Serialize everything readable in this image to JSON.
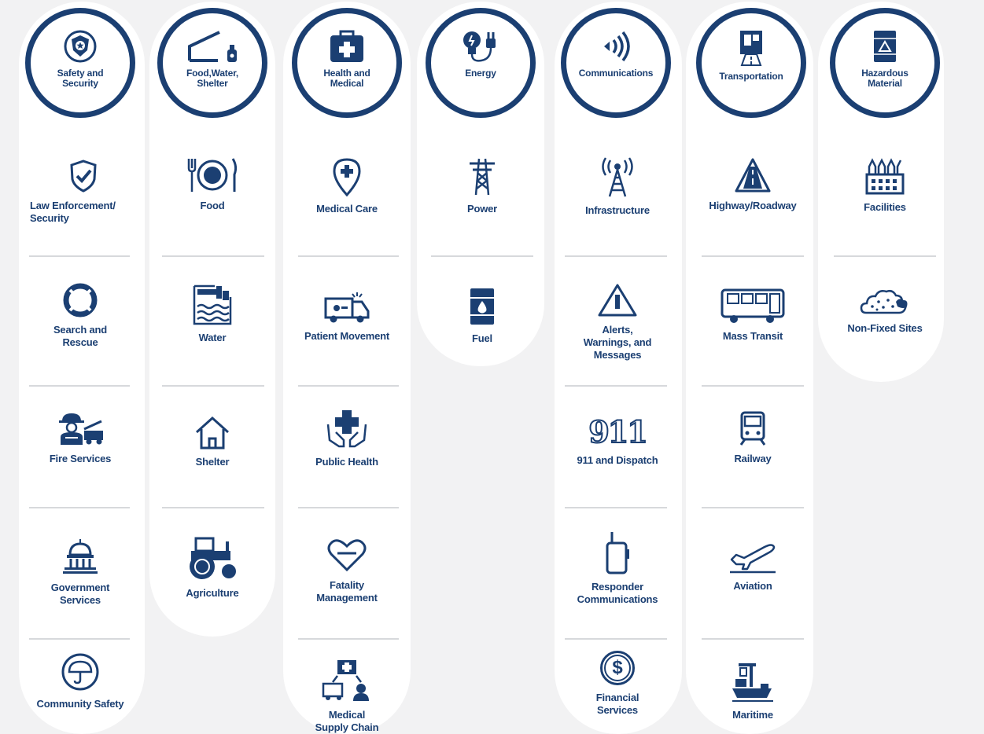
{
  "accent_color": "#1b3f72",
  "lifelines": [
    {
      "name": "Safety and\nSecurity",
      "icon": "police-badge-icon",
      "components": [
        {
          "label": "Law Enforcement/\nSecurity",
          "icon": "shield-check-icon"
        },
        {
          "label": "Search and\nRescue",
          "icon": "lifebuoy-icon"
        },
        {
          "label": "Fire Services",
          "icon": "firefighter-icon"
        },
        {
          "label": "Government\nServices",
          "icon": "capitol-icon"
        },
        {
          "label": "Community Safety",
          "icon": "umbrella-icon"
        }
      ]
    },
    {
      "name": "Food,Water,\nShelter",
      "icon": "shelter-bottle-icon",
      "components": [
        {
          "label": "Food",
          "icon": "plate-cutlery-icon"
        },
        {
          "label": "Water",
          "icon": "water-pipe-icon"
        },
        {
          "label": "Shelter",
          "icon": "house-icon"
        },
        {
          "label": "Agriculture",
          "icon": "tractor-icon"
        }
      ]
    },
    {
      "name": "Health and\nMedical",
      "icon": "medical-kit-icon",
      "components": [
        {
          "label": "Medical Care",
          "icon": "map-pin-cross-icon"
        },
        {
          "label": "Patient Movement",
          "icon": "ambulance-icon"
        },
        {
          "label": "Public Health",
          "icon": "hands-cross-icon"
        },
        {
          "label": "Fatality\nManagement",
          "icon": "heart-icon"
        },
        {
          "label": "Medical\nSupply Chain",
          "icon": "supply-chain-icon"
        }
      ]
    },
    {
      "name": "Energy",
      "icon": "bulb-plug-icon",
      "components": [
        {
          "label": "Power",
          "icon": "power-tower-icon"
        },
        {
          "label": "Fuel",
          "icon": "fuel-barrel-icon"
        }
      ]
    },
    {
      "name": "Communications",
      "icon": "signal-waves-icon",
      "components": [
        {
          "label": "Infrastructure",
          "icon": "radio-tower-icon"
        },
        {
          "label": "Alerts,\nWarnings,  and\nMessages",
          "icon": "warning-triangle-icon"
        },
        {
          "label": "911 and Dispatch",
          "icon": "911-icon",
          "glyph": "911"
        },
        {
          "label": "Responder\nCommunications",
          "icon": "radio-handset-icon"
        },
        {
          "label": "Financial\nServices",
          "icon": "dollar-coin-icon",
          "glyph": "$"
        }
      ]
    },
    {
      "name": "Transportation",
      "icon": "highway-truck-icon",
      "components": [
        {
          "label": "Highway/Roadway",
          "icon": "road-triangle-icon"
        },
        {
          "label": "Mass Transit",
          "icon": "bus-icon"
        },
        {
          "label": "Railway",
          "icon": "train-icon"
        },
        {
          "label": "Aviation",
          "icon": "airplane-icon"
        },
        {
          "label": "Maritime",
          "icon": "ship-crane-icon"
        }
      ]
    },
    {
      "name": "Hazardous\nMaterial",
      "icon": "hazmat-barrel-icon",
      "components": [
        {
          "label": "Facilities",
          "icon": "factory-icon"
        },
        {
          "label": "Non-Fixed Sites",
          "icon": "debris-cloud-icon"
        }
      ]
    }
  ]
}
